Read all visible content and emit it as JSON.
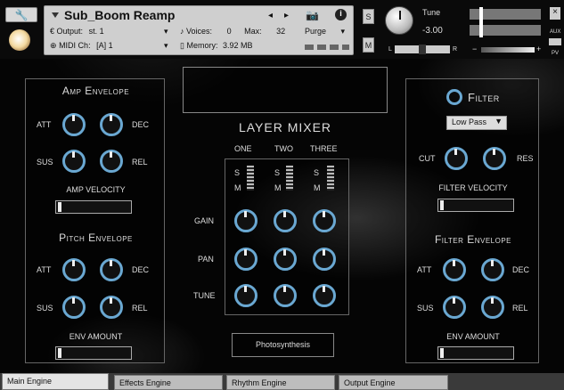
{
  "header": {
    "instrument_name": "Sub_Boom Reamp",
    "output_label": "Output:",
    "output_value": "st. 1",
    "midi_label": "MIDI Ch:",
    "midi_value": "[A]  1",
    "voices_label": "Voices:",
    "voices_value": "0",
    "max_label": "Max:",
    "max_value": "32",
    "memory_label": "Memory:",
    "memory_value": "3.92 MB",
    "purge_label": "Purge",
    "s_label": "S",
    "m_label": "M",
    "tune_label": "Tune",
    "tune_value": "-3.00",
    "l_label": "L",
    "r_label": "R",
    "aux_label": "AUX",
    "pv_label": "PV",
    "minus": "−",
    "plus": "+"
  },
  "amp_envelope": {
    "title": "Amp Envelope",
    "att": "ATT",
    "dec": "DEC",
    "sus": "SUS",
    "rel": "REL",
    "velocity_label": "AMP VELOCITY",
    "velocity": 0.05
  },
  "pitch_envelope": {
    "title": "Pitch Envelope",
    "att": "ATT",
    "dec": "DEC",
    "sus": "SUS",
    "rel": "REL",
    "env_amount_label": "ENV AMOUNT",
    "env_amount": 0.05
  },
  "layer_mixer": {
    "title": "LAYER MIXER",
    "layers": [
      "ONE",
      "TWO",
      "THREE"
    ],
    "s_label": "S",
    "m_label": "M",
    "rows": [
      "GAIN",
      "PAN",
      "TUNE"
    ],
    "preset": "Photosynthesis"
  },
  "filter": {
    "title": "Filter",
    "type": "Low Pass",
    "cut": "CUT",
    "res": "RES",
    "velocity_label": "FILTER VELOCITY",
    "velocity": 0.05
  },
  "filter_envelope": {
    "title": "Filter Envelope",
    "att": "ATT",
    "dec": "DEC",
    "sus": "SUS",
    "rel": "REL",
    "env_amount_label": "ENV AMOUNT",
    "env_amount": 0.05
  },
  "tabs": [
    "Main Engine",
    "Effects Engine",
    "Rhythm Engine",
    "Output Engine"
  ],
  "icons": [
    "wrench-icon",
    "camera-icon",
    "info-icon",
    "arrow-left-icon",
    "arrow-right-icon",
    "dropdown-arrow-icon"
  ]
}
